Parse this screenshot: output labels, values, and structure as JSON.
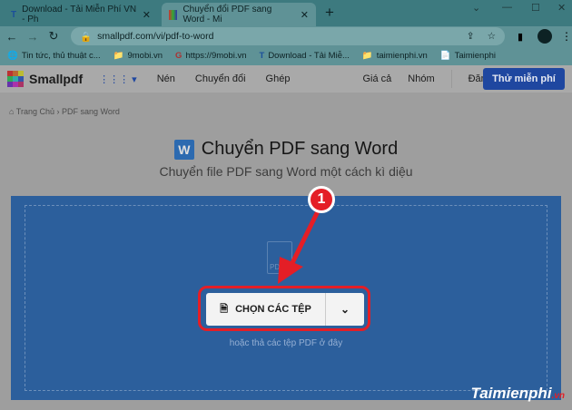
{
  "browser": {
    "tabs": [
      {
        "label": "Download - Tải Miễn Phí VN - Ph"
      },
      {
        "label": "Chuyển đổi PDF sang Word - Mi"
      }
    ],
    "url": "smallpdf.com/vi/pdf-to-word",
    "bookmarks": [
      "Tin tức, thủ thuật c...",
      "9mobi.vn",
      "https://9mobi.vn",
      "Download - Tải Miễ...",
      "taimienphi.vn",
      "Taimienphi"
    ]
  },
  "site": {
    "brand": "Smallpdf",
    "nav": [
      "Nén",
      "Chuyển đổi",
      "Ghép"
    ],
    "right_nav": [
      "Giá cả",
      "Nhóm"
    ],
    "login": "Đăng nhập",
    "cta": "Thử miễn phí"
  },
  "breadcrumb": {
    "home": "Trang Chủ",
    "sep": "›",
    "current": "PDF sang Word"
  },
  "page": {
    "icon_letter": "W",
    "title": "Chuyển PDF sang Word",
    "subtitle": "Chuyển file PDF sang Word một cách kì diệu",
    "choose_button": "CHỌN CÁC TỆP",
    "hint": "hoặc thả các tệp PDF ở đây",
    "pdf_label": "PDF"
  },
  "annotation": {
    "step": "1"
  },
  "watermark": {
    "text": "Taimienphi",
    "suffix": ".vn"
  }
}
